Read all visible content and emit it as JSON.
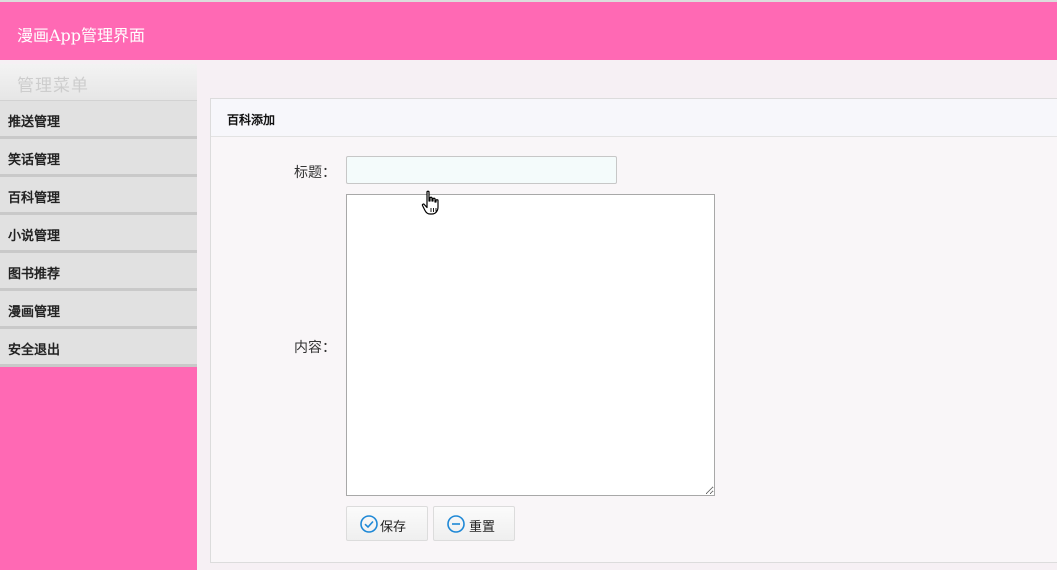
{
  "app": {
    "title": "漫画App管理界面"
  },
  "sidebar": {
    "heading": "管理菜单",
    "items": [
      {
        "label": "推送管理"
      },
      {
        "label": "笑话管理"
      },
      {
        "label": "百科管理"
      },
      {
        "label": "小说管理"
      },
      {
        "label": "图书推荐"
      },
      {
        "label": "漫画管理"
      },
      {
        "label": "安全退出"
      }
    ]
  },
  "panel": {
    "title": "百科添加"
  },
  "form": {
    "title_label": "标题：",
    "title_value": "",
    "content_label": "内容：",
    "content_value": ""
  },
  "buttons": {
    "save": "保存",
    "reset": "重置"
  },
  "icons": {
    "save": "check-circle-icon",
    "reset": "minus-circle-icon",
    "cursor": "hand-pointer-icon"
  },
  "colors": {
    "header_bg": "#ff69b4",
    "sidebar_bg": "#ff69b4",
    "menu_item_bg": "#e1e1e1",
    "icon_blue": "#1e88d6"
  }
}
